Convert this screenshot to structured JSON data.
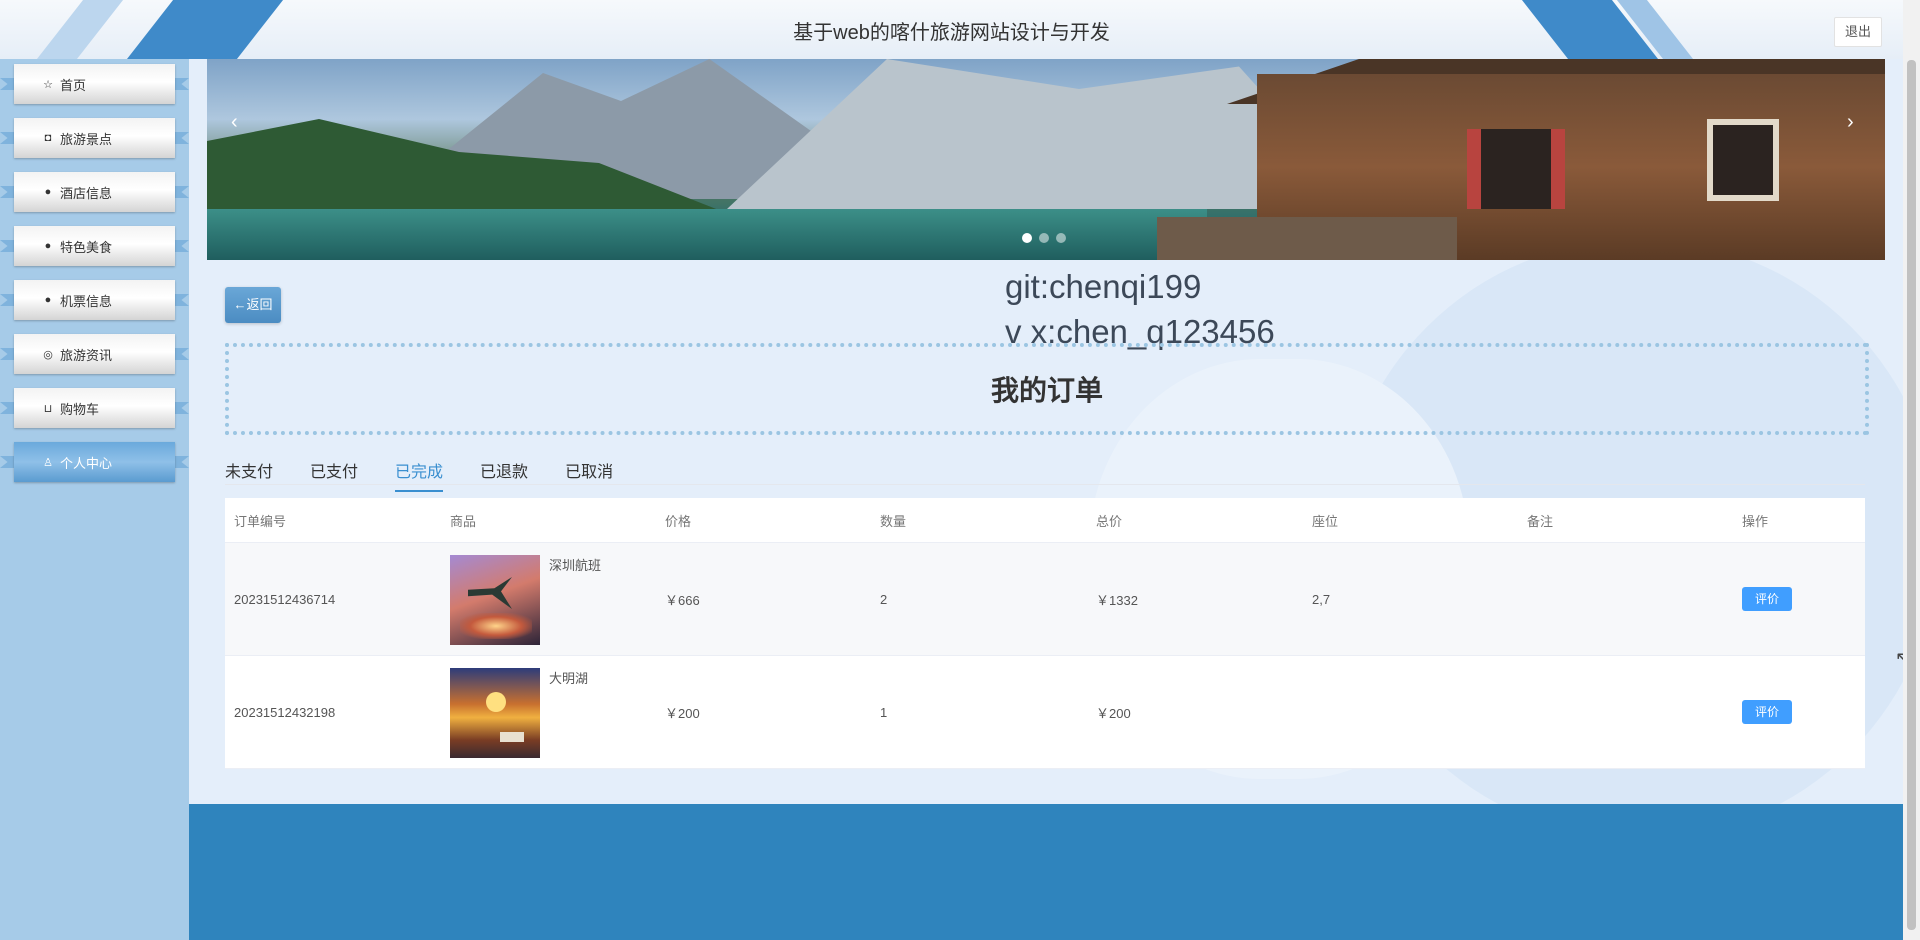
{
  "header": {
    "title": "基于web的喀什旅游网站设计与开发",
    "logout_label": "退出"
  },
  "sidebar": {
    "items": [
      {
        "label": "首页",
        "icon": "star-icon",
        "glyph": "☆"
      },
      {
        "label": "旅游景点",
        "icon": "bag-icon",
        "glyph": "◘"
      },
      {
        "label": "酒店信息",
        "icon": "info-circle-icon",
        "glyph": "●"
      },
      {
        "label": "特色美食",
        "icon": "question-circle-icon",
        "glyph": "●"
      },
      {
        "label": "机票信息",
        "icon": "info-circle-icon",
        "glyph": "●"
      },
      {
        "label": "旅游资讯",
        "icon": "globe-icon",
        "glyph": "◎"
      },
      {
        "label": "购物车",
        "icon": "cart-icon",
        "glyph": "⊔"
      },
      {
        "label": "个人中心",
        "icon": "user-icon",
        "glyph": "♙",
        "active": true
      }
    ]
  },
  "carousel": {
    "prev": "‹",
    "next": "›",
    "slides": 3,
    "current": 1
  },
  "back_label": "←返回",
  "watermark": {
    "line1": "git:chenqi199",
    "line2": "v x:chen_q123456"
  },
  "page_title": "我的订单",
  "tabs": [
    "未支付",
    "已支付",
    "已完成",
    "已退款",
    "已取消"
  ],
  "active_tab": "已完成",
  "table": {
    "headers": [
      "订单编号",
      "商品",
      "价格",
      "数量",
      "总价",
      "座位",
      "备注",
      "操作"
    ],
    "rows": [
      {
        "order_no": "20231512436714",
        "goods": "深圳航班",
        "price": "￥666",
        "qty": "2",
        "total": "￥1332",
        "seat": "2,7",
        "remark": "",
        "action": "评价"
      },
      {
        "order_no": "20231512432198",
        "goods": "大明湖",
        "price": "￥200",
        "qty": "1",
        "total": "￥200",
        "seat": "",
        "remark": "",
        "action": "评价"
      }
    ]
  },
  "colors": {
    "accent": "#409eff",
    "sidebar_bg": "#a6cbe8",
    "footer": "#2f84bd",
    "active_tab": "#3a8fd0"
  }
}
